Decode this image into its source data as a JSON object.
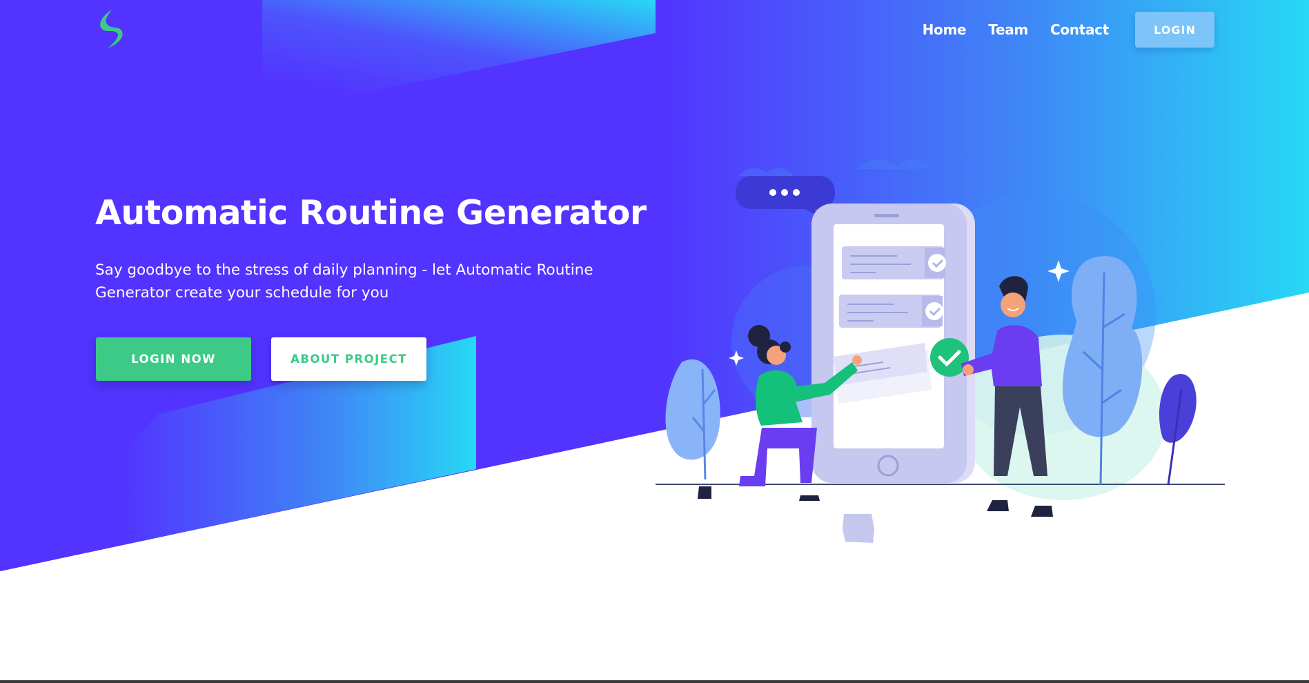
{
  "nav": {
    "items": [
      {
        "label": "Home"
      },
      {
        "label": "Team"
      },
      {
        "label": "Contact"
      }
    ],
    "login_label": "LOGIN"
  },
  "hero": {
    "title": "Automatic Routine Generator",
    "subtitle": "Say goodbye to the stress of daily planning - let Automatic Routine Generator create your schedule for you",
    "primary_button": "LOGIN NOW",
    "secondary_button": "ABOUT PROJECT"
  },
  "colors": {
    "primary_purple": "#5233ff",
    "gradient_cyan": "#27d8f5",
    "accent_green": "#3cca86",
    "login_blue": "#7cc4fa"
  },
  "icons": {
    "logo": "lightning-bolt-logo",
    "illustration": "team-phone-checklist-illustration"
  }
}
